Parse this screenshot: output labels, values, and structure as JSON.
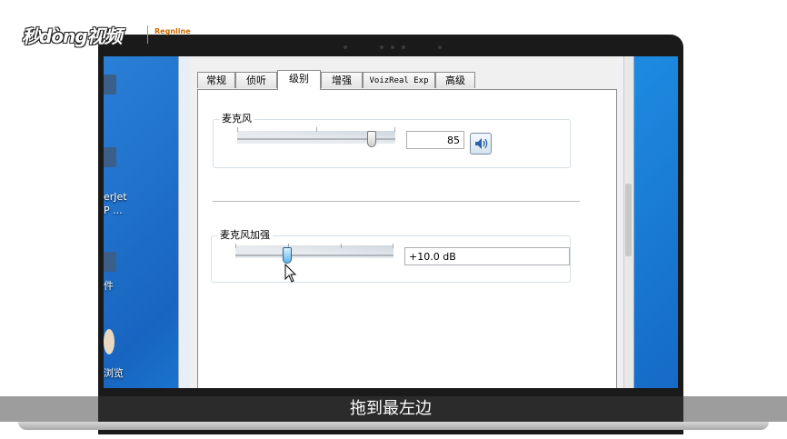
{
  "logo": {
    "text": "秒dòng视频",
    "brand": "Regnline"
  },
  "desktop": {
    "labels": [
      "erJet",
      "P ...",
      "件",
      "浏览"
    ]
  },
  "dialog": {
    "tabs": [
      {
        "label": "常规",
        "active": false
      },
      {
        "label": "侦听",
        "active": false
      },
      {
        "label": "级别",
        "active": true
      },
      {
        "label": "增强",
        "active": false
      },
      {
        "label": "VoizReal Exp",
        "active": false
      },
      {
        "label": "高级",
        "active": false
      }
    ],
    "microphone": {
      "title": "麦克风",
      "value": "85",
      "level": 85,
      "speaker_icon": "speaker-icon"
    },
    "boost": {
      "title": "麦克风加强",
      "value": "+10.0 dB",
      "level_fraction": 0.33
    }
  },
  "subtitle": "拖到最左边",
  "colors": {
    "desktop": "#1d72cf",
    "thumb_blue": "#5eb6ee",
    "subtitle_bg": "#2b2b2b"
  }
}
